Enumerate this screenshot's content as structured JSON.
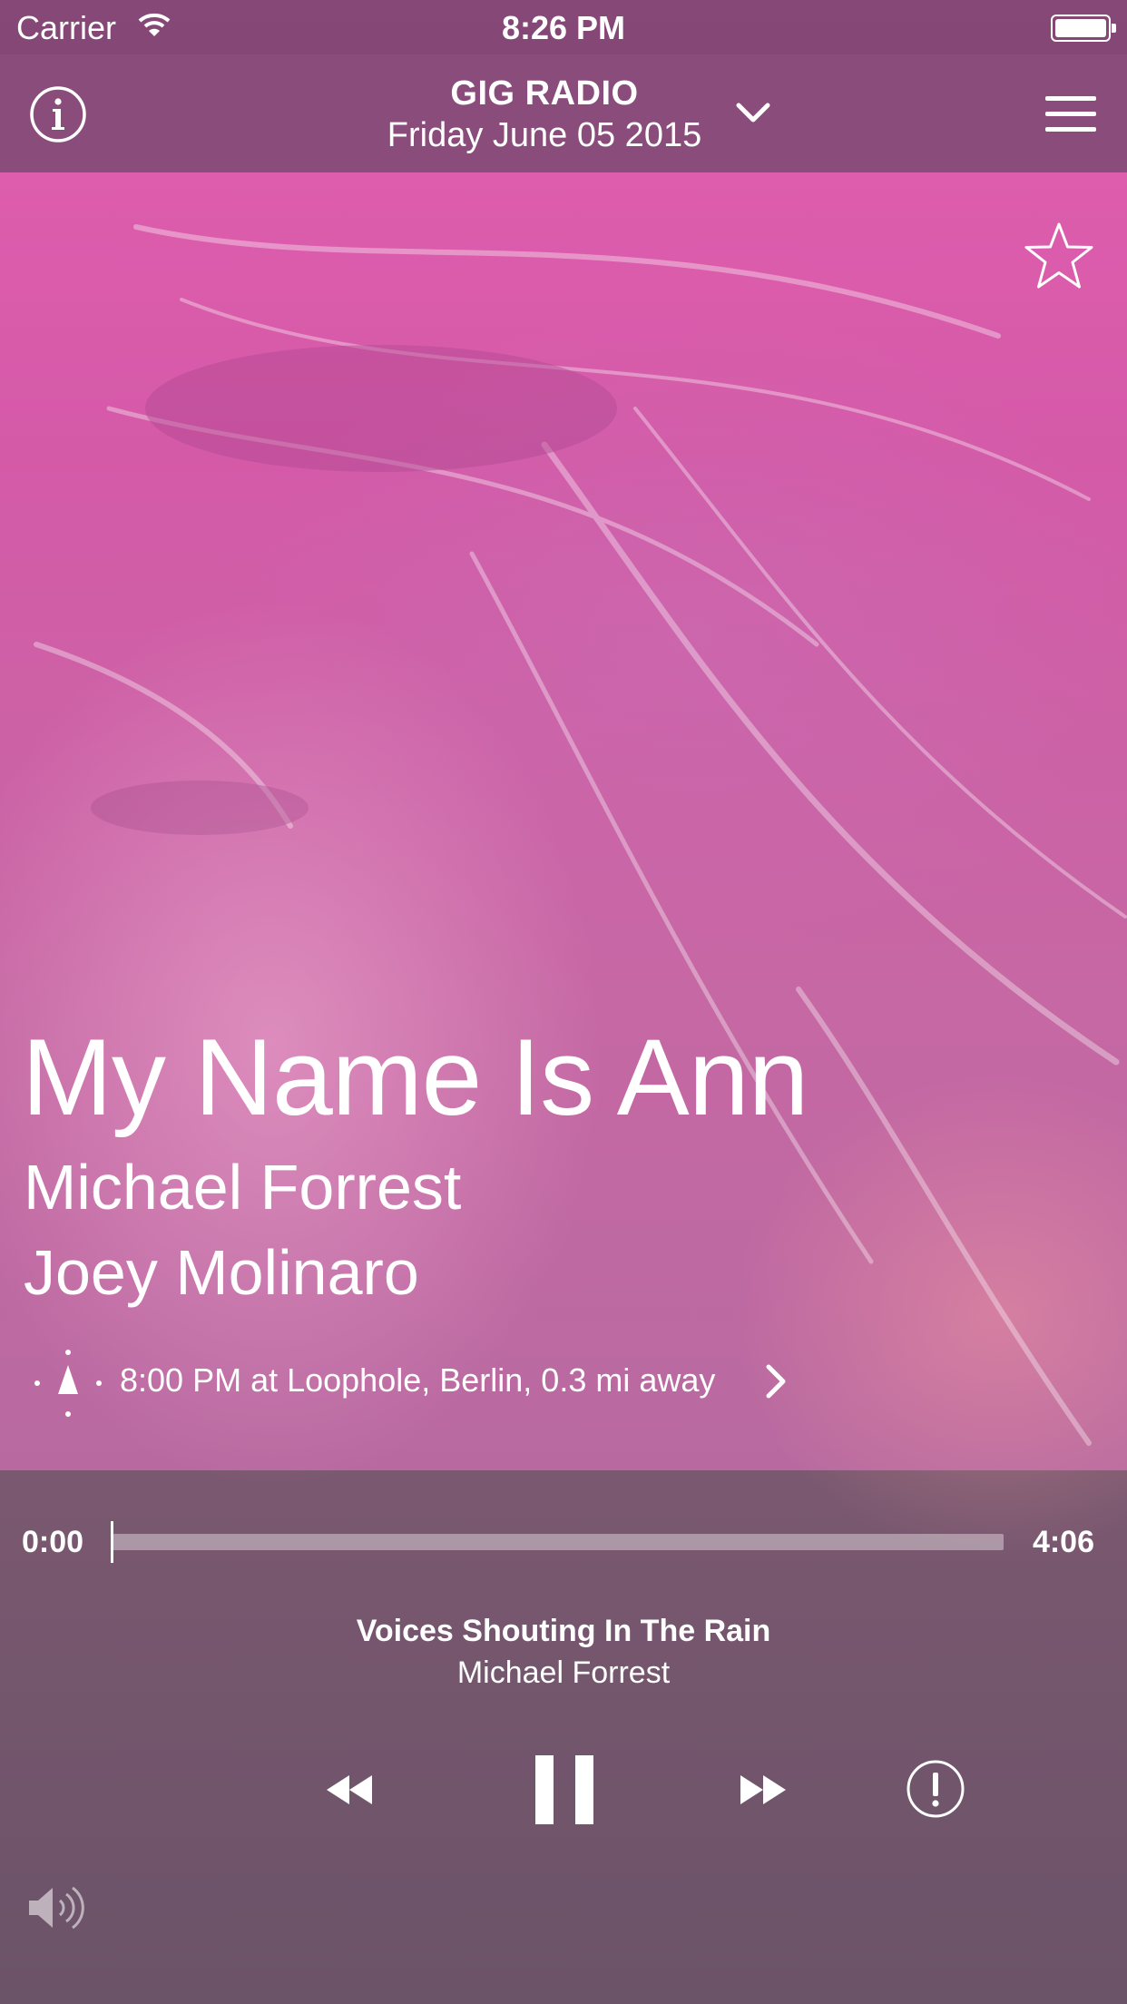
{
  "status_bar": {
    "carrier": "Carrier",
    "time": "8:26 PM",
    "wifi_icon": "wifi-icon",
    "battery_icon": "battery-icon"
  },
  "header": {
    "title": "GIG RADIO",
    "date": "Friday June 05 2015",
    "info_icon": "info-icon",
    "dropdown_icon": "chevron-down-icon",
    "menu_icon": "hamburger-menu-icon"
  },
  "gig": {
    "favorite_icon": "star-outline-icon",
    "title": "My Name Is Ann",
    "artists": [
      "Michael Forrest",
      "Joey Molinaro"
    ],
    "details": "8:00 PM at Loophole, Berlin, 0.3 mi away",
    "location_icon": "location-compass-icon",
    "details_chevron_icon": "chevron-right-icon"
  },
  "player": {
    "elapsed": "0:00",
    "duration": "4:06",
    "progress_fraction": 0.0,
    "track_title": "Voices Shouting In The Rain",
    "track_artist": "Michael Forrest",
    "controls": {
      "rewind_icon": "rewind-icon",
      "pause_icon": "pause-icon",
      "fast_forward_icon": "fast-forward-icon",
      "report_icon": "exclamation-circle-icon",
      "volume_icon": "speaker-volume-icon"
    }
  },
  "colors": {
    "artwork_tint": "#d45aa8",
    "header_bar": "#804a76",
    "player_panel": "#6b5368",
    "text": "#ffffff"
  }
}
